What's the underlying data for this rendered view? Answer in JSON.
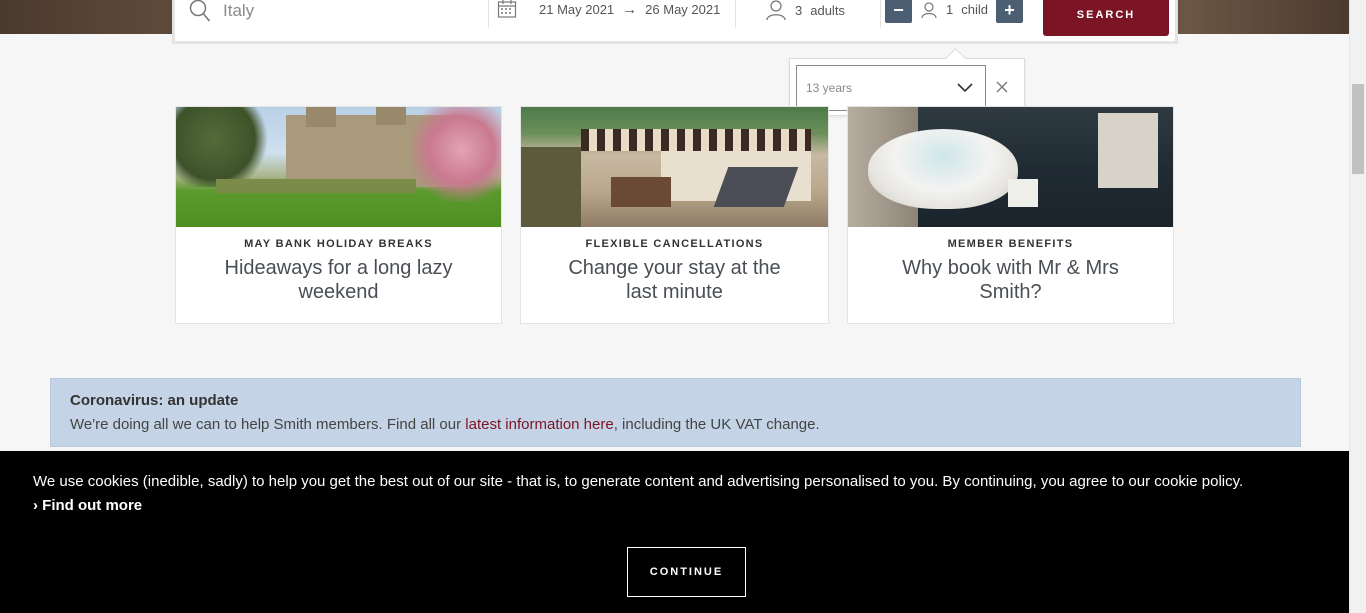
{
  "search": {
    "destination": "Italy",
    "check_in": "21 May 2021",
    "arrow": "→",
    "check_out": "26 May 2021",
    "adults_count": "3",
    "adults_label": "adults",
    "children_count": "1",
    "children_label": "child",
    "minus": "−",
    "plus": "+",
    "search_label": "SEARCH"
  },
  "child_age": {
    "selected": "13 years"
  },
  "cards": [
    {
      "kicker": "MAY BANK HOLIDAY BREAKS",
      "headline": "Hideaways for a long lazy weekend"
    },
    {
      "kicker": "FLEXIBLE CANCELLATIONS",
      "headline": "Change your stay at the last minute"
    },
    {
      "kicker": "MEMBER BENEFITS",
      "headline": "Why book with Mr & Mrs Smith?"
    }
  ],
  "notice": {
    "title": "Coronavirus: an update",
    "body_start": "We're doing all we can to help Smith members. Find all our ",
    "link": "latest information here",
    "body_end": ", including the UK VAT change."
  },
  "cookie": {
    "text": "We use cookies (inedible, sadly) to help you get the best out of our site - that is, to generate content and advertising personalised to you. By continuing, you agree to our cookie policy.",
    "find_out_more": "› Find out more",
    "continue": "CONTINUE"
  },
  "colors": {
    "accent": "#7b1425",
    "stepper": "#4c5f72",
    "notice_bg": "#c4d4e6"
  }
}
